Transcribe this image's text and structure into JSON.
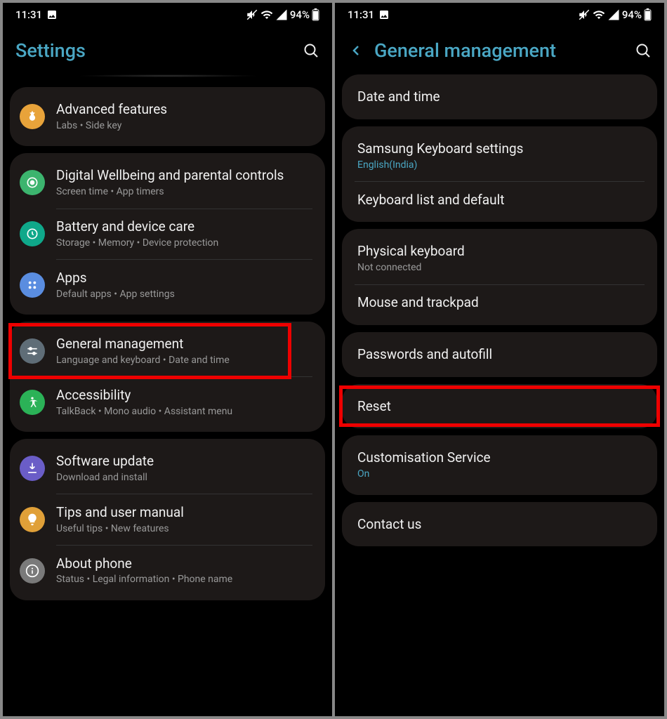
{
  "status": {
    "time": "11:31",
    "battery": "94%"
  },
  "left": {
    "title": "Settings",
    "groups": [
      [
        {
          "icon": "advanced",
          "color": "#e8a33a",
          "title": "Advanced features",
          "sub": "Labs  •  Side key"
        }
      ],
      [
        {
          "icon": "wellbeing",
          "color": "#3cb46e",
          "title": "Digital Wellbeing and parental controls",
          "sub": "Screen time  •  App timers"
        },
        {
          "icon": "battery",
          "color": "#0fa88a",
          "title": "Battery and device care",
          "sub": "Storage  •  Memory  •  Device protection"
        },
        {
          "icon": "apps",
          "color": "#5a8de0",
          "title": "Apps",
          "sub": "Default apps  •  App settings"
        }
      ],
      [
        {
          "icon": "general",
          "color": "#5f6d77",
          "title": "General management",
          "sub": "Language and keyboard  •  Date and time",
          "highlight": true
        },
        {
          "icon": "accessibility",
          "color": "#2bb257",
          "title": "Accessibility",
          "sub": "TalkBack  •  Mono audio  •  Assistant menu"
        }
      ],
      [
        {
          "icon": "update",
          "color": "#6a5dc7",
          "title": "Software update",
          "sub": "Download and install"
        },
        {
          "icon": "tips",
          "color": "#e0a038",
          "title": "Tips and user manual",
          "sub": "Useful tips  •  New features"
        },
        {
          "icon": "about",
          "color": "#7a7a7a",
          "title": "About phone",
          "sub": "Status  •  Legal information  •  Phone name"
        }
      ]
    ]
  },
  "right": {
    "title": "General management",
    "groups": [
      [
        {
          "title": "Date and time"
        }
      ],
      [
        {
          "title": "Samsung Keyboard settings",
          "sub": "English(India)",
          "subAccent": true
        },
        {
          "title": "Keyboard list and default"
        }
      ],
      [
        {
          "title": "Physical keyboard",
          "sub": "Not connected"
        },
        {
          "title": "Mouse and trackpad"
        }
      ],
      [
        {
          "title": "Passwords and autofill"
        }
      ],
      [
        {
          "title": "Reset",
          "highlight": true
        }
      ],
      [
        {
          "title": "Customisation Service",
          "sub": "On",
          "subAccent": true
        }
      ],
      [
        {
          "title": "Contact us"
        }
      ]
    ]
  }
}
